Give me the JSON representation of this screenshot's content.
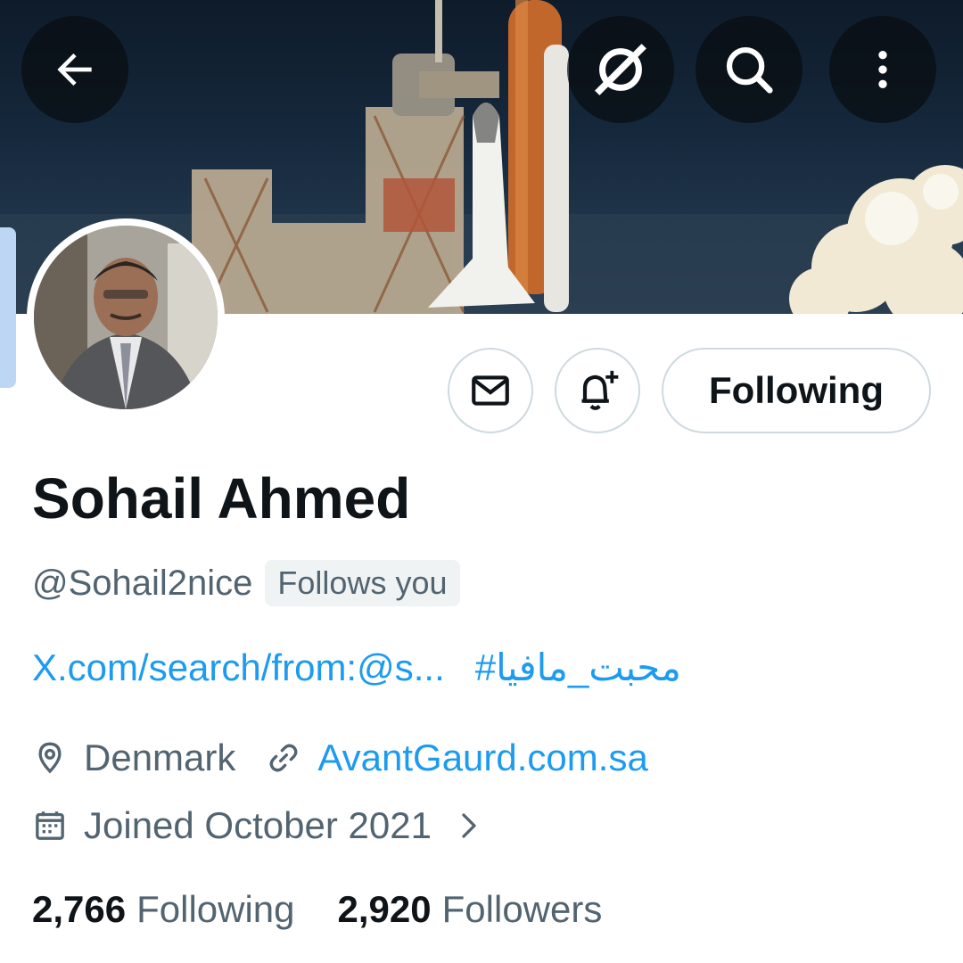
{
  "header": {
    "back_icon": "arrow-left-icon",
    "grok_icon": "slash-circle-icon",
    "search_icon": "search-icon",
    "more_icon": "more-vertical-icon"
  },
  "profile": {
    "name": "Sohail Ahmed",
    "handle": "@Sohail2nice",
    "follows_you": "Follows you",
    "bio_link": "X.com/search/from:@s...",
    "bio_hashtag": "#محبت_مافیا",
    "location": "Denmark",
    "website": "AvantGaurd.com.sa",
    "joined": "Joined October 2021",
    "following_count": "2,766",
    "following_label": "Following",
    "followers_count": "2,920",
    "followers_label": "Followers"
  },
  "actions": {
    "message_icon": "mail-icon",
    "notify_icon": "bell-plus-icon",
    "follow_button": "Following"
  },
  "colors": {
    "accent": "#1d9bf0",
    "muted_text": "#536471",
    "primary_text": "#0f1419",
    "border": "#cfd9de"
  }
}
